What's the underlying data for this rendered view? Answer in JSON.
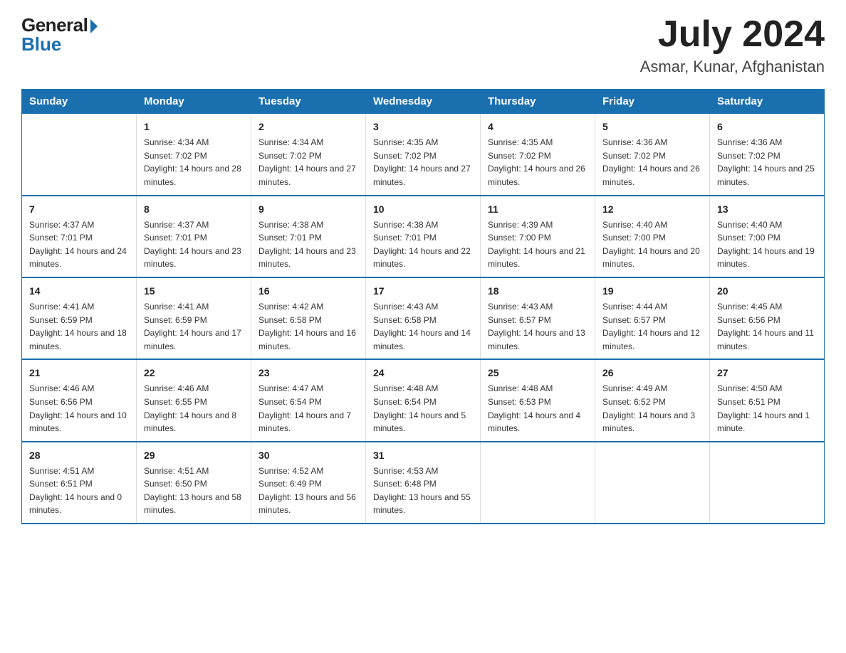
{
  "logo": {
    "general": "General",
    "blue": "Blue"
  },
  "title": {
    "month_year": "July 2024",
    "location": "Asmar, Kunar, Afghanistan"
  },
  "days_of_week": [
    "Sunday",
    "Monday",
    "Tuesday",
    "Wednesday",
    "Thursday",
    "Friday",
    "Saturday"
  ],
  "weeks": [
    [
      {
        "day": "",
        "sunrise": "",
        "sunset": "",
        "daylight": ""
      },
      {
        "day": "1",
        "sunrise": "Sunrise: 4:34 AM",
        "sunset": "Sunset: 7:02 PM",
        "daylight": "Daylight: 14 hours and 28 minutes."
      },
      {
        "day": "2",
        "sunrise": "Sunrise: 4:34 AM",
        "sunset": "Sunset: 7:02 PM",
        "daylight": "Daylight: 14 hours and 27 minutes."
      },
      {
        "day": "3",
        "sunrise": "Sunrise: 4:35 AM",
        "sunset": "Sunset: 7:02 PM",
        "daylight": "Daylight: 14 hours and 27 minutes."
      },
      {
        "day": "4",
        "sunrise": "Sunrise: 4:35 AM",
        "sunset": "Sunset: 7:02 PM",
        "daylight": "Daylight: 14 hours and 26 minutes."
      },
      {
        "day": "5",
        "sunrise": "Sunrise: 4:36 AM",
        "sunset": "Sunset: 7:02 PM",
        "daylight": "Daylight: 14 hours and 26 minutes."
      },
      {
        "day": "6",
        "sunrise": "Sunrise: 4:36 AM",
        "sunset": "Sunset: 7:02 PM",
        "daylight": "Daylight: 14 hours and 25 minutes."
      }
    ],
    [
      {
        "day": "7",
        "sunrise": "Sunrise: 4:37 AM",
        "sunset": "Sunset: 7:01 PM",
        "daylight": "Daylight: 14 hours and 24 minutes."
      },
      {
        "day": "8",
        "sunrise": "Sunrise: 4:37 AM",
        "sunset": "Sunset: 7:01 PM",
        "daylight": "Daylight: 14 hours and 23 minutes."
      },
      {
        "day": "9",
        "sunrise": "Sunrise: 4:38 AM",
        "sunset": "Sunset: 7:01 PM",
        "daylight": "Daylight: 14 hours and 23 minutes."
      },
      {
        "day": "10",
        "sunrise": "Sunrise: 4:38 AM",
        "sunset": "Sunset: 7:01 PM",
        "daylight": "Daylight: 14 hours and 22 minutes."
      },
      {
        "day": "11",
        "sunrise": "Sunrise: 4:39 AM",
        "sunset": "Sunset: 7:00 PM",
        "daylight": "Daylight: 14 hours and 21 minutes."
      },
      {
        "day": "12",
        "sunrise": "Sunrise: 4:40 AM",
        "sunset": "Sunset: 7:00 PM",
        "daylight": "Daylight: 14 hours and 20 minutes."
      },
      {
        "day": "13",
        "sunrise": "Sunrise: 4:40 AM",
        "sunset": "Sunset: 7:00 PM",
        "daylight": "Daylight: 14 hours and 19 minutes."
      }
    ],
    [
      {
        "day": "14",
        "sunrise": "Sunrise: 4:41 AM",
        "sunset": "Sunset: 6:59 PM",
        "daylight": "Daylight: 14 hours and 18 minutes."
      },
      {
        "day": "15",
        "sunrise": "Sunrise: 4:41 AM",
        "sunset": "Sunset: 6:59 PM",
        "daylight": "Daylight: 14 hours and 17 minutes."
      },
      {
        "day": "16",
        "sunrise": "Sunrise: 4:42 AM",
        "sunset": "Sunset: 6:58 PM",
        "daylight": "Daylight: 14 hours and 16 minutes."
      },
      {
        "day": "17",
        "sunrise": "Sunrise: 4:43 AM",
        "sunset": "Sunset: 6:58 PM",
        "daylight": "Daylight: 14 hours and 14 minutes."
      },
      {
        "day": "18",
        "sunrise": "Sunrise: 4:43 AM",
        "sunset": "Sunset: 6:57 PM",
        "daylight": "Daylight: 14 hours and 13 minutes."
      },
      {
        "day": "19",
        "sunrise": "Sunrise: 4:44 AM",
        "sunset": "Sunset: 6:57 PM",
        "daylight": "Daylight: 14 hours and 12 minutes."
      },
      {
        "day": "20",
        "sunrise": "Sunrise: 4:45 AM",
        "sunset": "Sunset: 6:56 PM",
        "daylight": "Daylight: 14 hours and 11 minutes."
      }
    ],
    [
      {
        "day": "21",
        "sunrise": "Sunrise: 4:46 AM",
        "sunset": "Sunset: 6:56 PM",
        "daylight": "Daylight: 14 hours and 10 minutes."
      },
      {
        "day": "22",
        "sunrise": "Sunrise: 4:46 AM",
        "sunset": "Sunset: 6:55 PM",
        "daylight": "Daylight: 14 hours and 8 minutes."
      },
      {
        "day": "23",
        "sunrise": "Sunrise: 4:47 AM",
        "sunset": "Sunset: 6:54 PM",
        "daylight": "Daylight: 14 hours and 7 minutes."
      },
      {
        "day": "24",
        "sunrise": "Sunrise: 4:48 AM",
        "sunset": "Sunset: 6:54 PM",
        "daylight": "Daylight: 14 hours and 5 minutes."
      },
      {
        "day": "25",
        "sunrise": "Sunrise: 4:48 AM",
        "sunset": "Sunset: 6:53 PM",
        "daylight": "Daylight: 14 hours and 4 minutes."
      },
      {
        "day": "26",
        "sunrise": "Sunrise: 4:49 AM",
        "sunset": "Sunset: 6:52 PM",
        "daylight": "Daylight: 14 hours and 3 minutes."
      },
      {
        "day": "27",
        "sunrise": "Sunrise: 4:50 AM",
        "sunset": "Sunset: 6:51 PM",
        "daylight": "Daylight: 14 hours and 1 minute."
      }
    ],
    [
      {
        "day": "28",
        "sunrise": "Sunrise: 4:51 AM",
        "sunset": "Sunset: 6:51 PM",
        "daylight": "Daylight: 14 hours and 0 minutes."
      },
      {
        "day": "29",
        "sunrise": "Sunrise: 4:51 AM",
        "sunset": "Sunset: 6:50 PM",
        "daylight": "Daylight: 13 hours and 58 minutes."
      },
      {
        "day": "30",
        "sunrise": "Sunrise: 4:52 AM",
        "sunset": "Sunset: 6:49 PM",
        "daylight": "Daylight: 13 hours and 56 minutes."
      },
      {
        "day": "31",
        "sunrise": "Sunrise: 4:53 AM",
        "sunset": "Sunset: 6:48 PM",
        "daylight": "Daylight: 13 hours and 55 minutes."
      },
      {
        "day": "",
        "sunrise": "",
        "sunset": "",
        "daylight": ""
      },
      {
        "day": "",
        "sunrise": "",
        "sunset": "",
        "daylight": ""
      },
      {
        "day": "",
        "sunrise": "",
        "sunset": "",
        "daylight": ""
      }
    ]
  ]
}
